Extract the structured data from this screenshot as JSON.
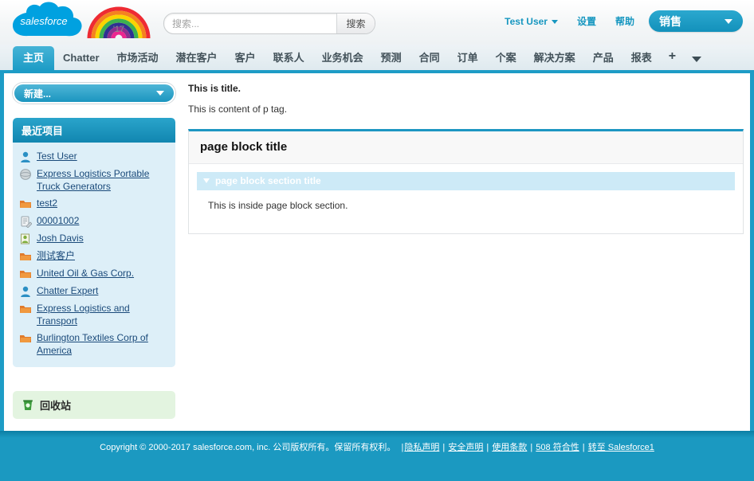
{
  "header": {
    "logo_text": "salesforce",
    "rainbow_year": "'17",
    "search": {
      "placeholder": "搜索...",
      "value": "",
      "button_label": "搜索"
    },
    "user_menu_label": "Test User",
    "setup_label": "设置",
    "help_label": "帮助",
    "app_menu_label": "销售"
  },
  "tabs": [
    {
      "label": "主页",
      "active": true
    },
    {
      "label": "Chatter",
      "active": false
    },
    {
      "label": "市场活动",
      "active": false
    },
    {
      "label": "潜在客户",
      "active": false
    },
    {
      "label": "客户",
      "active": false
    },
    {
      "label": "联系人",
      "active": false
    },
    {
      "label": "业务机会",
      "active": false
    },
    {
      "label": "预测",
      "active": false
    },
    {
      "label": "合同",
      "active": false
    },
    {
      "label": "订单",
      "active": false
    },
    {
      "label": "个案",
      "active": false
    },
    {
      "label": "解决方案",
      "active": false
    },
    {
      "label": "产品",
      "active": false
    },
    {
      "label": "报表",
      "active": false
    }
  ],
  "tab_add_label": "+",
  "sidebar": {
    "new_button_label": "新建...",
    "recent_items_title": "最近项目",
    "recent_items": [
      {
        "label": "Test User",
        "icon": "user-icon"
      },
      {
        "label": "Express Logistics Portable Truck Generators",
        "icon": "product-icon"
      },
      {
        "label": "test2",
        "icon": "account-icon"
      },
      {
        "label": "00001002",
        "icon": "contract-icon"
      },
      {
        "label": "Josh Davis",
        "icon": "lead-icon"
      },
      {
        "label": "测试客户",
        "icon": "account-icon"
      },
      {
        "label": "United Oil & Gas Corp.",
        "icon": "account-icon"
      },
      {
        "label": "Chatter Expert",
        "icon": "user-icon"
      },
      {
        "label": "Express Logistics and Transport",
        "icon": "account-icon"
      },
      {
        "label": "Burlington Textiles Corp of America",
        "icon": "account-icon"
      }
    ],
    "recycle_bin_label": "回收站"
  },
  "main": {
    "title": "This is title.",
    "paragraph": "This is content of p tag.",
    "pageblock_title": "page block title",
    "pageblock_section_title": "page block section title",
    "pageblock_section_body": "This is inside page block section."
  },
  "footer": {
    "copyright": "Copyright © 2000-2017 salesforce.com, inc. 公司版权所有。保留所有权利。",
    "links": [
      "隐私声明",
      "安全声明",
      "使用条款",
      "508 符合性",
      "转至 Salesforce1"
    ]
  },
  "colors": {
    "brand_blue": "#1d9cc6",
    "link_blue": "#1a4a7a",
    "accent_teal": "#1b99c1",
    "section_header_bg": "#cdeaf7"
  }
}
